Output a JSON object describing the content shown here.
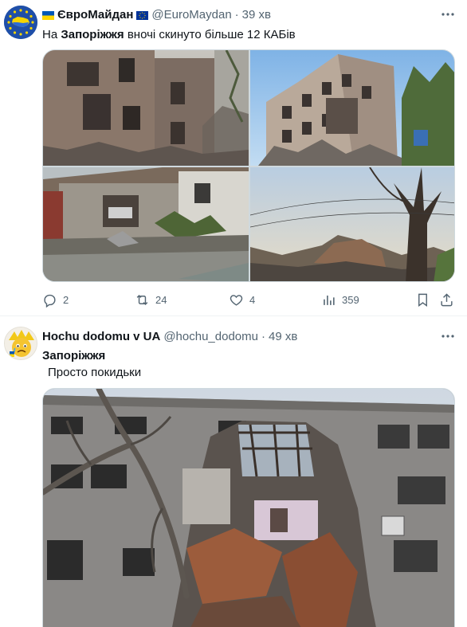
{
  "tweet1": {
    "author_name": "ЄвроМайдан",
    "handle": "@EuroMaydan",
    "separator": "·",
    "time": "39 хв",
    "text_prefix": "На ",
    "text_bold": "Запоріжжя",
    "text_suffix": " вночі скинуто більше 12 КАБів",
    "actions": {
      "replies": "2",
      "reposts": "24",
      "likes": "4",
      "views": "359"
    }
  },
  "tweet2": {
    "author_name": "Hochu dodomu v UA",
    "handle": "@hochu_dodomu",
    "separator": "·",
    "time": "49 хв",
    "text_line1": "Запоріжжя",
    "text_line2": "Просто  покидьки"
  },
  "icons": {
    "flag": "ukraine-flag-icon",
    "eu_flag": "eu-flag-icon",
    "more": "more-icon",
    "reply": "reply-icon",
    "repost": "repost-icon",
    "like": "like-icon",
    "views": "views-icon",
    "bookmark": "bookmark-icon",
    "share": "share-icon"
  },
  "colors": {
    "text": "#0f1419",
    "secondary": "#536471",
    "border": "#cfd9de"
  }
}
